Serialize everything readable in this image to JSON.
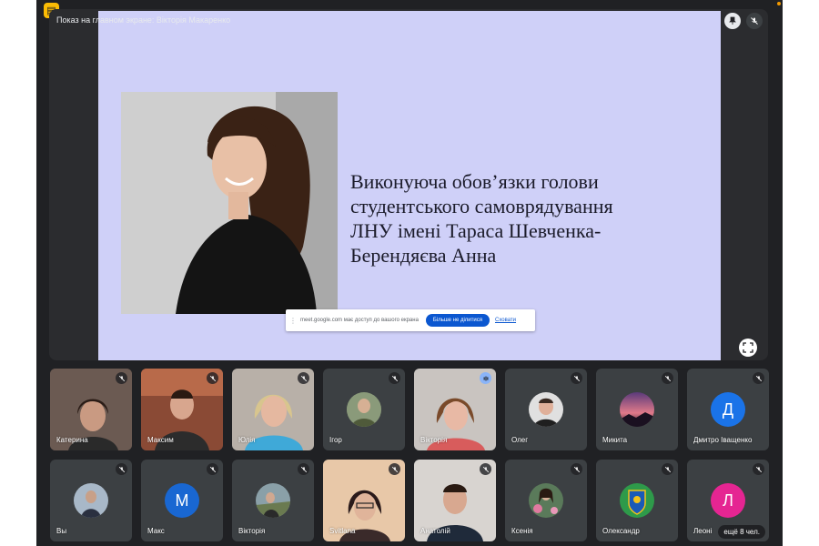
{
  "app": {
    "icon_glyph": "▤",
    "accent": "#fbbc04"
  },
  "presentation": {
    "label": "Показ на главном экране: Вікторія Макаренко",
    "slide_lines": [
      "Виконуюча обов’язки голови",
      "студентського самоврядування",
      "ЛНУ імені Тараса Шевченка-",
      "Берендяєва Анна"
    ],
    "slide_bg": "#cfd0f8"
  },
  "share_bar": {
    "message": "meet.google.com має доступ до вашого екрана",
    "stop_label": "Більше не ділитися",
    "hide_label": "Сховати"
  },
  "participants_row1": [
    {
      "name": "Катерина",
      "type": "video",
      "mic": "muted"
    },
    {
      "name": "Максим",
      "type": "video",
      "mic": "muted"
    },
    {
      "name": "Юлія",
      "type": "video",
      "mic": "muted"
    },
    {
      "name": "Ігор",
      "type": "avatar-photo",
      "mic": "muted"
    },
    {
      "name": "Вікторія",
      "type": "video",
      "mic": "speaking"
    },
    {
      "name": "Олег",
      "type": "avatar-photo",
      "mic": "muted"
    },
    {
      "name": "Микита",
      "type": "avatar-photo",
      "mic": "muted"
    },
    {
      "name": "Дмитро Іващенко",
      "type": "avatar-letter",
      "letter": "Д",
      "color": "#1a73e8",
      "mic": "muted"
    }
  ],
  "participants_row2": [
    {
      "name": "Вы",
      "type": "avatar-photo",
      "mic": "muted"
    },
    {
      "name": "Макс",
      "type": "avatar-letter",
      "letter": "М",
      "color": "#1967d2",
      "mic": "muted"
    },
    {
      "name": "Вікторія",
      "type": "avatar-photo",
      "mic": "muted"
    },
    {
      "name": "Svitlana",
      "type": "video",
      "mic": "muted"
    },
    {
      "name": "Анатолій",
      "type": "video",
      "mic": "muted"
    },
    {
      "name": "Ксенія",
      "type": "avatar-photo",
      "mic": "muted"
    },
    {
      "name": "Олександр",
      "type": "avatar-photo",
      "mic": "muted"
    },
    {
      "name": "Леоні",
      "type": "avatar-letter",
      "letter": "Л",
      "color": "#e52592",
      "mic": "muted"
    }
  ],
  "more_participants": "ещё 8 чел."
}
